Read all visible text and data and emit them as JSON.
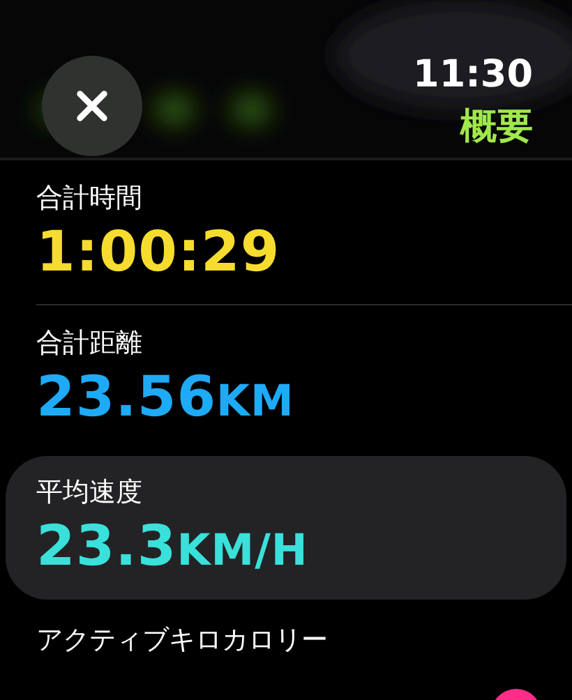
{
  "header": {
    "time": "11:30",
    "title": "概要"
  },
  "metrics": [
    {
      "label": "合計時間",
      "value": "1:00:29",
      "color": "#f7dc30",
      "selected": false
    },
    {
      "label": "合計距離",
      "value": "23.56",
      "unit": "KM",
      "color": "#1eaaf7",
      "selected": false
    },
    {
      "label": "平均速度",
      "value": "23.3",
      "unit": "KM/H",
      "color": "#3ae0da",
      "selected": true
    },
    {
      "label": "アクティブキロカロリー",
      "color": "#ff2d87",
      "selected": false
    }
  ]
}
